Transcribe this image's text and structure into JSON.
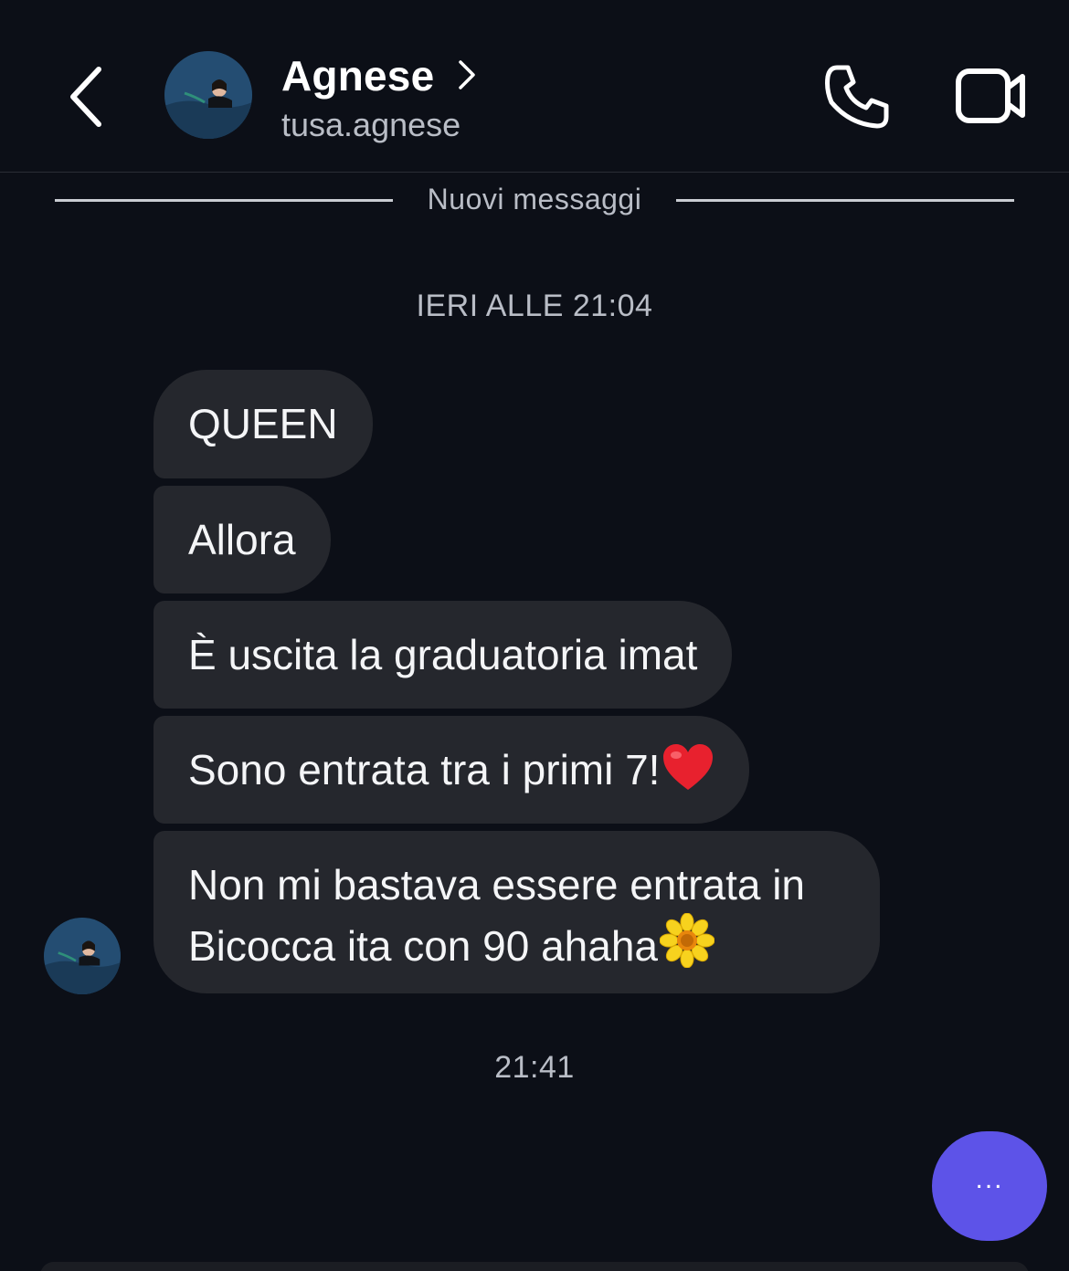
{
  "header": {
    "contact_name": "Agnese",
    "username": "tusa.agnese"
  },
  "divider": {
    "label": "Nuovi messaggi"
  },
  "thread": {
    "timestamp_top": "IERI ALLE 21:04",
    "messages": [
      {
        "text": "QUEEN"
      },
      {
        "text": "Allora"
      },
      {
        "text": "È uscita la graduatoria imat"
      },
      {
        "text": "Sono entrata tra i primi 7!",
        "emoji": "heart"
      },
      {
        "text": "Non mi bastava essere entrata in Bicocca ita con 90 ahaha",
        "emoji": "sunflower"
      }
    ],
    "timestamp_bottom": "21:41"
  },
  "fab": {
    "label": "..."
  },
  "colors": {
    "background": "#0c0f17",
    "bubble": "#25272d",
    "fab": "#5d53e8",
    "muted_text": "#b9bdc6"
  },
  "icons": {
    "back": "chevron-left-icon",
    "profile_link": "chevron-right-icon",
    "call": "phone-icon",
    "video": "video-camera-icon",
    "heart_emoji": "red-heart-emoji",
    "flower_emoji": "sunflower-emoji"
  }
}
